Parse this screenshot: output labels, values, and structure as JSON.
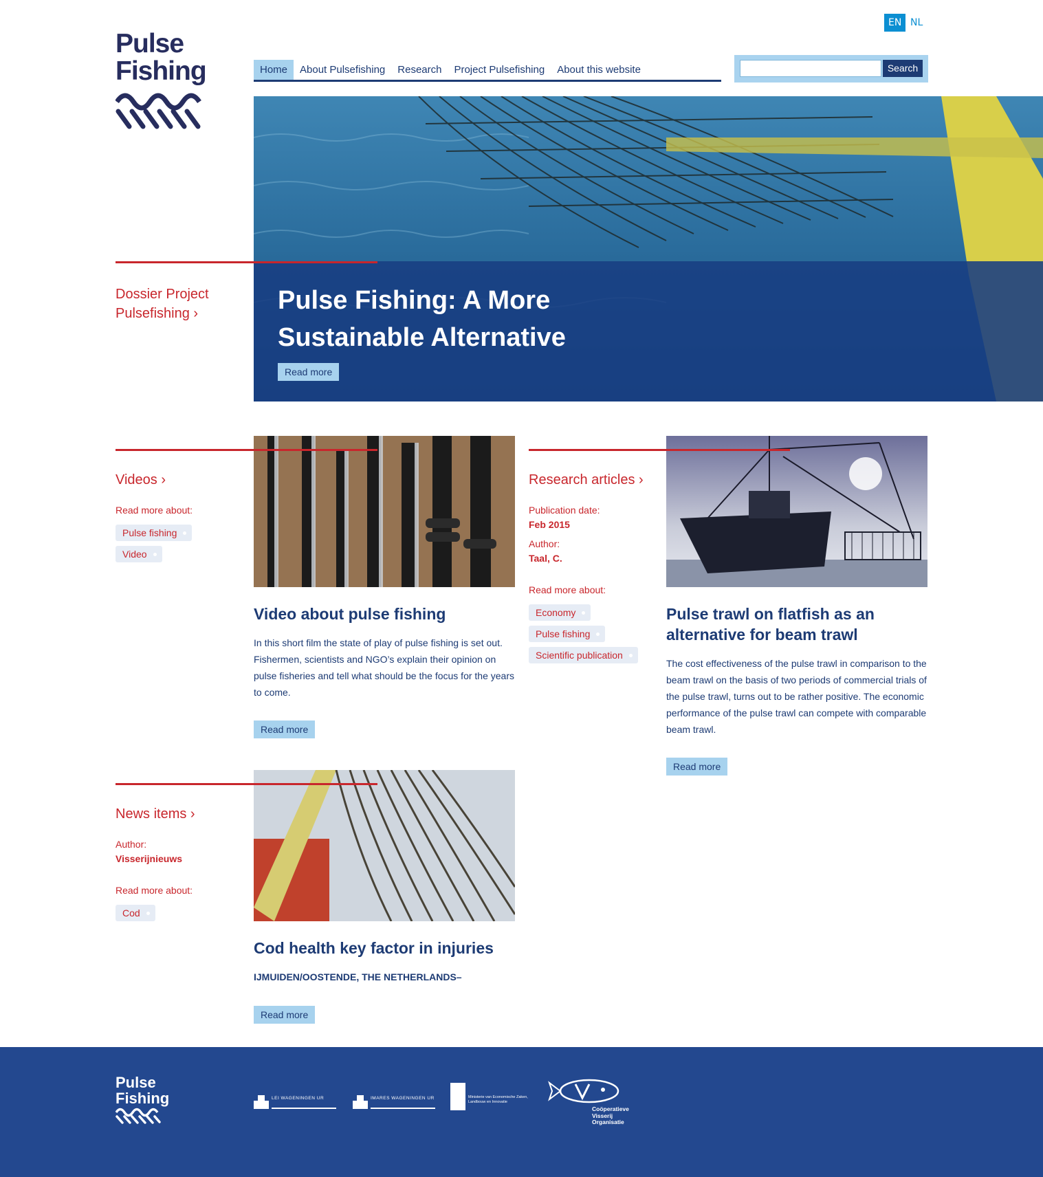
{
  "lang": {
    "en": "EN",
    "nl": "NL"
  },
  "logo": {
    "line1": "Pulse",
    "line2": "Fishing"
  },
  "nav": {
    "home": "Home",
    "about": "About Pulsefishing",
    "research": "Research",
    "project": "Project Pulsefishing",
    "website": "About this website"
  },
  "search": {
    "button": "Search",
    "placeholder": ""
  },
  "hero": {
    "sidebar_link": "Dossier Project Pulsefishing ›",
    "title": "Pulse Fishing: A More Sustainable Alternative",
    "button": "Read more"
  },
  "videos": {
    "section": "Videos ›",
    "read_more_about": "Read more about:",
    "tags": [
      "Pulse fishing",
      "Video"
    ],
    "title": "Video about pulse fishing",
    "text": "In this short film the state of play of pulse fishing is set out. Fishermen, scientists and NGO’s explain their opinion on pulse fisheries and tell what should be the focus for the years to come.",
    "button": "Read more"
  },
  "research": {
    "section": "Research articles ›",
    "pub_label": "Publication date:",
    "pub_value": "Feb 2015",
    "author_label": "Author:",
    "author_value": "Taal, C.",
    "read_more_about": "Read more about:",
    "tags": [
      "Economy",
      "Pulse fishing",
      "Scientific publication"
    ],
    "title": "Pulse trawl on flatfish as an alternative for beam trawl",
    "text": "The cost effectiveness of the pulse trawl in comparison to the beam trawl on the basis of two periods of commercial trials of the pulse trawl, turns out to be rather positive. The economic performance of the pulse trawl can compete with comparable beam trawl.",
    "button": "Read more"
  },
  "news": {
    "section": "News items ›",
    "author_label": "Author:",
    "author_value": "Visserijnieuws",
    "read_more_about": "Read more about:",
    "tags": [
      "Cod"
    ],
    "title": "Cod health key factor in injuries",
    "dateline": "IJMUIDEN/OOSTENDE, THE NETHERLANDS–",
    "button": "Read more"
  },
  "footer": {
    "logo_line1": "Pulse",
    "logo_line2": "Fishing",
    "partner_lei": "LEI WAGENINGEN UR",
    "partner_imares": "IMARES WAGENINGEN UR",
    "partner_ministry": "Ministerie van Economische Zaken, Landbouw en Innovatie",
    "partner_cvo": "Coöperatieve Visserij Organisatie"
  },
  "colors": {
    "brand_blue": "#1d3b74",
    "accent_red": "#c8262c",
    "light_blue": "#a7d2ee",
    "lang_blue": "#0c8fd2"
  }
}
